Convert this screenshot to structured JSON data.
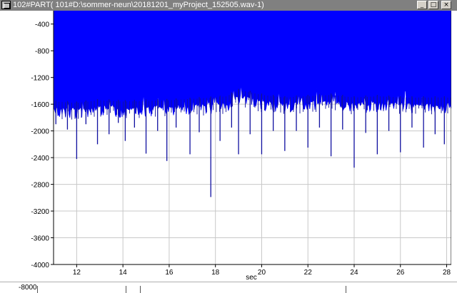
{
  "window": {
    "title": "102#PART( 101#D:\\sommer-neun\\20181201_myProject_152505.wav-1)",
    "buttons": {
      "minimize": "_",
      "maximize": "□",
      "close": "×"
    }
  },
  "chart_data": {
    "type": "line",
    "title": "",
    "xlabel": "sec",
    "ylabel": "",
    "xlim": [
      11,
      28.2
    ],
    "ylim": [
      -4000,
      -200
    ],
    "x_ticks": [
      12,
      14,
      16,
      18,
      20,
      22,
      24,
      26,
      28
    ],
    "y_ticks": [
      -400,
      -800,
      -1200,
      -1600,
      -2000,
      -2400,
      -2800,
      -3200,
      -3600,
      -4000
    ],
    "grid": true,
    "series": [
      {
        "color": "#0000ff",
        "fill_top": -200,
        "baseline_envelope": [
          [
            11.0,
            -1620
          ],
          [
            12.0,
            -1640
          ],
          [
            13.0,
            -1600
          ],
          [
            14.0,
            -1620
          ],
          [
            15.0,
            -1610
          ],
          [
            16.0,
            -1600
          ],
          [
            17.0,
            -1580
          ],
          [
            18.0,
            -1560
          ],
          [
            18.5,
            -1540
          ],
          [
            19.0,
            -1450
          ],
          [
            19.5,
            -1480
          ],
          [
            20.0,
            -1520
          ],
          [
            21.0,
            -1560
          ],
          [
            22.0,
            -1540
          ],
          [
            23.0,
            -1520
          ],
          [
            24.0,
            -1560
          ],
          [
            25.0,
            -1540
          ],
          [
            26.0,
            -1560
          ],
          [
            27.0,
            -1560
          ],
          [
            28.0,
            -1560
          ],
          [
            28.2,
            -1560
          ]
        ],
        "spikes": [
          [
            11.1,
            -1900
          ],
          [
            11.6,
            -1980
          ],
          [
            12.0,
            -2420
          ],
          [
            12.4,
            -1900
          ],
          [
            12.9,
            -2200
          ],
          [
            13.4,
            -2050
          ],
          [
            13.8,
            -1880
          ],
          [
            14.1,
            -2150
          ],
          [
            14.5,
            -1950
          ],
          [
            15.0,
            -2340
          ],
          [
            15.5,
            -2000
          ],
          [
            15.9,
            -2450
          ],
          [
            16.3,
            -1950
          ],
          [
            16.9,
            -2350
          ],
          [
            17.3,
            -2020
          ],
          [
            17.8,
            -2990
          ],
          [
            18.2,
            -2150
          ],
          [
            18.7,
            -1950
          ],
          [
            19.0,
            -2350
          ],
          [
            19.5,
            -2050
          ],
          [
            20.0,
            -2350
          ],
          [
            20.5,
            -2000
          ],
          [
            21.0,
            -2300
          ],
          [
            21.5,
            -2000
          ],
          [
            22.0,
            -2250
          ],
          [
            22.5,
            -1950
          ],
          [
            23.0,
            -2380
          ],
          [
            23.5,
            -1980
          ],
          [
            24.0,
            -2550
          ],
          [
            24.5,
            -2030
          ],
          [
            25.0,
            -2350
          ],
          [
            25.5,
            -2000
          ],
          [
            26.0,
            -2320
          ],
          [
            26.5,
            -1950
          ],
          [
            27.0,
            -2250
          ],
          [
            27.5,
            -2050
          ],
          [
            27.9,
            -2200
          ]
        ]
      }
    ]
  },
  "bottom_panel": {
    "y_label": "-8000"
  }
}
